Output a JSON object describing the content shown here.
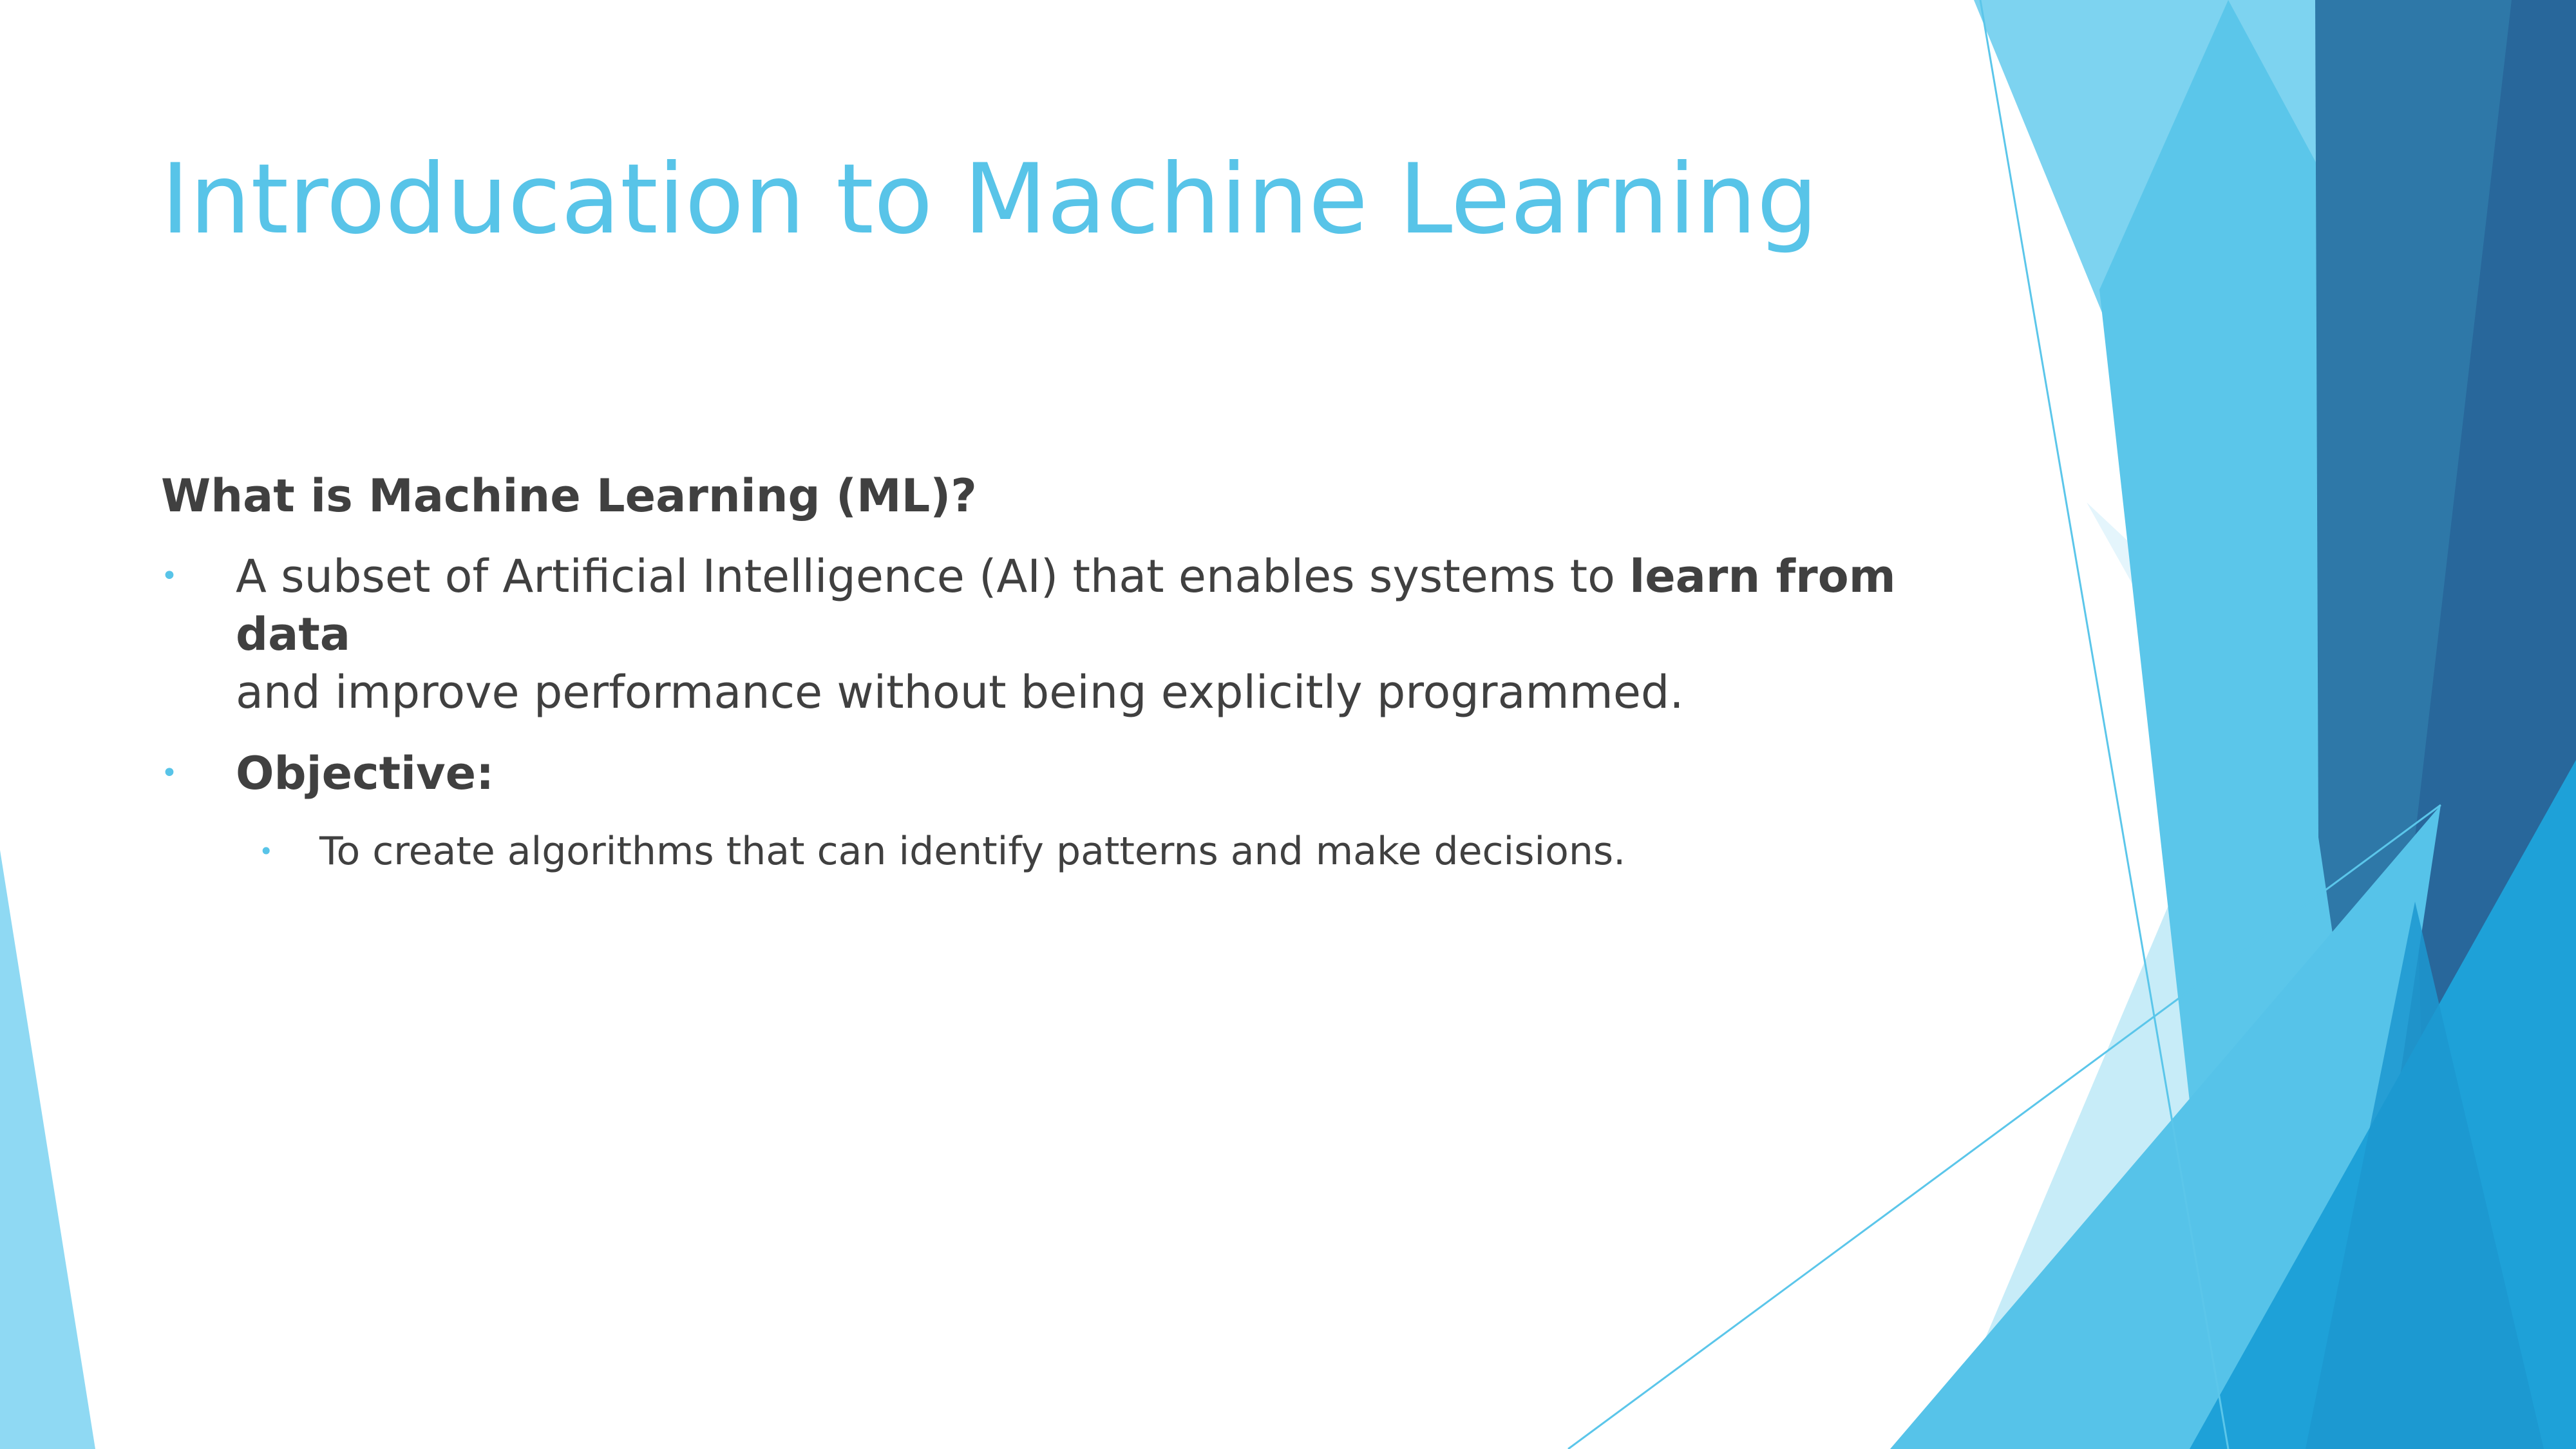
{
  "slide": {
    "title": "Introducation to Machine Learning",
    "heading": "What is Machine Learning (ML)?",
    "bullet_marker": "•",
    "bullets": [
      {
        "text_before": "A subset of Artificial Intelligence (AI) that enables systems to ",
        "text_bold": "learn from data",
        "line_2": "and improve performance without being explicitly programmed."
      },
      {
        "text_bold": "Objective:"
      }
    ],
    "sub_bullets": [
      {
        "text": "To create algorithms that can identify patterns and make decisions."
      }
    ]
  },
  "theme": {
    "title_color": "#58c4e8",
    "text_color": "#404040",
    "accent_light": "#7dd3f0",
    "accent_mid": "#2fb4e6",
    "accent_dark": "#2a6a9e",
    "background": "#ffffff"
  }
}
